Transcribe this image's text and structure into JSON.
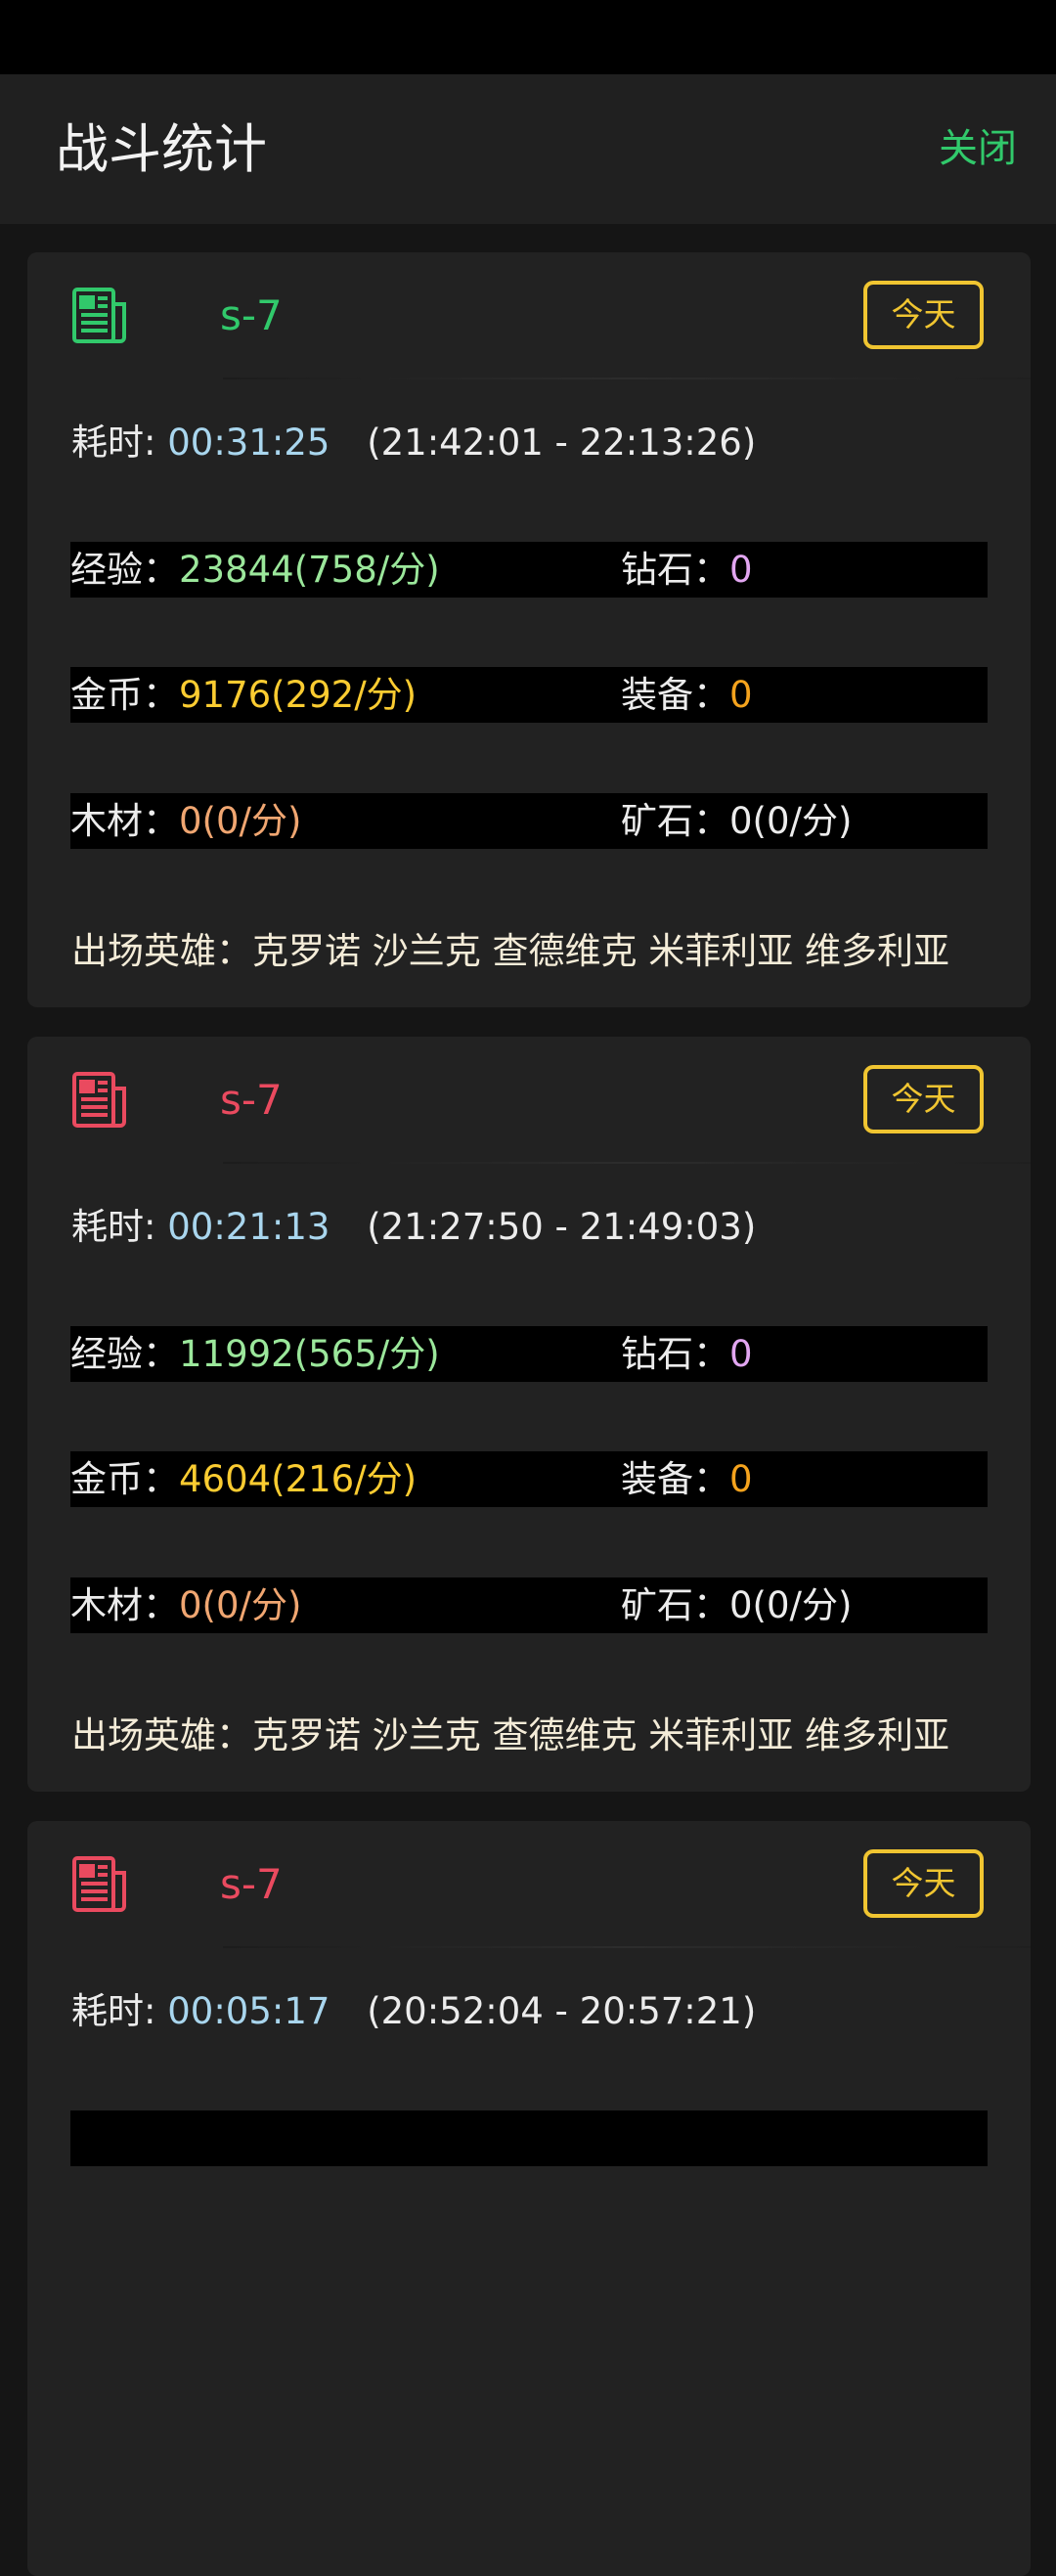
{
  "app_bar": {
    "title": "战斗统计",
    "close_label": "关闭"
  },
  "colors": {
    "accent_green": "#31c96b",
    "accent_red": "#ea4a5f",
    "badge_yellow": "#f0c531"
  },
  "records": [
    {
      "icon": "newspaper-icon",
      "status_color": "#31c96b",
      "name": "s-7",
      "badge": "今天",
      "duration_label": "耗时:",
      "duration": "00:31:25",
      "time_range": "(21:42:01 - 22:13:26)",
      "exp_label": "经验：",
      "exp_value": "23844(758/分)",
      "diamond_label": "钻石：",
      "diamond_value": "0",
      "gold_label": "金币：",
      "gold_value": "9176(292/分)",
      "equip_label": "装备：",
      "equip_value": "0",
      "wood_label": "木材：",
      "wood_value": "0(0/分)",
      "ore_label": "矿石：",
      "ore_value": "0(0/分)",
      "heroes_label": "出场英雄：",
      "heroes": "克罗诺 沙兰克 查德维克 米菲利亚 维多利亚"
    },
    {
      "icon": "newspaper-icon",
      "status_color": "#ea4a5f",
      "name": "s-7",
      "badge": "今天",
      "duration_label": "耗时:",
      "duration": "00:21:13",
      "time_range": "(21:27:50 - 21:49:03)",
      "exp_label": "经验：",
      "exp_value": "11992(565/分)",
      "diamond_label": "钻石：",
      "diamond_value": "0",
      "gold_label": "金币：",
      "gold_value": "4604(216/分)",
      "equip_label": "装备：",
      "equip_value": "0",
      "wood_label": "木材：",
      "wood_value": "0(0/分)",
      "ore_label": "矿石：",
      "ore_value": "0(0/分)",
      "heroes_label": "出场英雄：",
      "heroes": "克罗诺 沙兰克 查德维克 米菲利亚 维多利亚"
    },
    {
      "icon": "newspaper-icon",
      "status_color": "#ea4a5f",
      "name": "s-7",
      "badge": "今天",
      "duration_label": "耗时:",
      "duration": "00:05:17",
      "time_range": "(20:52:04 - 20:57:21)"
    }
  ]
}
